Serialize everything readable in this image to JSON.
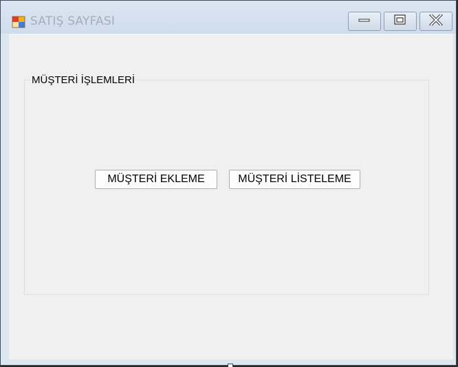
{
  "window": {
    "title": "SATIŞ SAYFASI",
    "icon": "app-window-icon",
    "controls": {
      "minimize_icon": "minimize-icon",
      "maximize_icon": "maximize-icon",
      "close_icon": "close-icon"
    }
  },
  "group": {
    "legend": "MÜŞTERİ İŞLEMLERİ",
    "buttons": {
      "add_customer": "MÜŞTERİ EKLEME",
      "list_customers": "MÜŞTERİ LİSTELEME"
    }
  },
  "colors": {
    "client_background": "#f0f0f0",
    "titlebar": "#dbe6f3",
    "title_text": "#a7adb6"
  }
}
